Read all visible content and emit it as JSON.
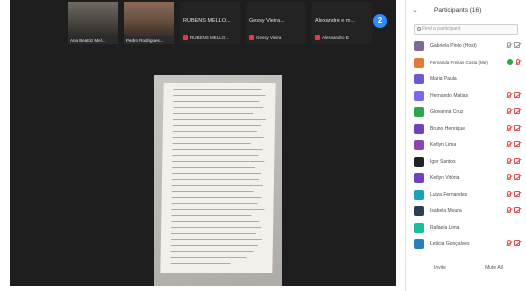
{
  "gallery": {
    "thumbs": [
      {
        "name": "Ana Beatriz Mel..."
      },
      {
        "name": "Pedro Rodrigues..."
      }
    ],
    "tiles": [
      {
        "title": "RUBENS MELLO...",
        "sub": "RUBENS MELLO..."
      },
      {
        "title": "Gessy Vieira...",
        "sub": "Gessy Vieira"
      },
      {
        "title": "Alexandre e m...",
        "sub": "Alessandro B"
      }
    ],
    "more_count": "2"
  },
  "sidebar": {
    "title": "Participants (16)",
    "search_placeholder": "Find a participant",
    "participants": [
      {
        "name": "Gabriela Pinto (Host)",
        "color": "#7a6a9a",
        "status": "gray"
      },
      {
        "name": "Fernanda Freitas Costa (Me)",
        "color": "#e07b39",
        "status": "green"
      },
      {
        "name": "Maria Paula",
        "color": "#6a5acd",
        "status": "none"
      },
      {
        "name": "Hernando Matias",
        "color": "#7b68ee",
        "status": "red"
      },
      {
        "name": "Giovanna Cruz",
        "color": "#2ea44f",
        "status": "red"
      },
      {
        "name": "Bruno Henrique",
        "color": "#6f42c1",
        "status": "red"
      },
      {
        "name": "Ketlyn Lima",
        "color": "#8e44ad",
        "status": "red"
      },
      {
        "name": "Igor Santos",
        "color": "#222222",
        "status": "red"
      },
      {
        "name": "Ketlyn Vitória",
        "color": "#6f42c1",
        "status": "red"
      },
      {
        "name": "Luiza Fernandes",
        "color": "#17a2b8",
        "status": "red"
      },
      {
        "name": "Isabela Moura",
        "color": "#2c3e50",
        "status": "red"
      },
      {
        "name": "Rafaela Lima",
        "color": "#1abc9c",
        "status": "none"
      },
      {
        "name": "Leticia Gonçalves",
        "color": "#2980b9",
        "status": "red"
      }
    ],
    "footer": {
      "invite": "Invite",
      "mute_all": "Mute All"
    }
  }
}
